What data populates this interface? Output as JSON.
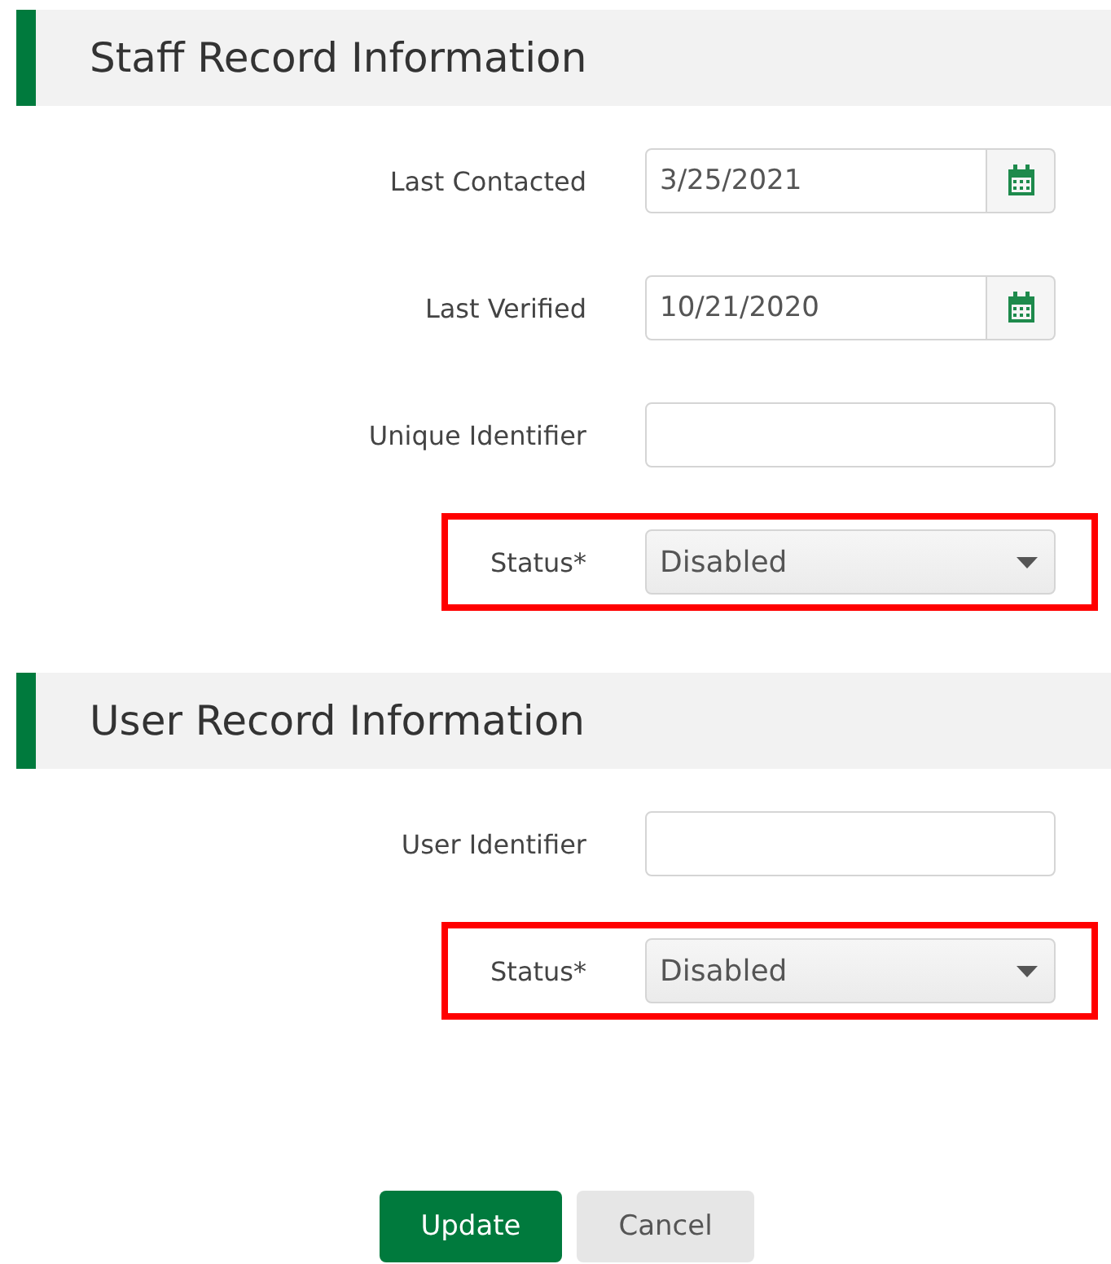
{
  "sections": [
    {
      "title": "Staff Record Information",
      "fields": [
        {
          "kind": "date",
          "label": "Last Contacted",
          "value": "3/25/2021",
          "highlighted": false
        },
        {
          "kind": "date",
          "label": "Last Verified",
          "value": "10/21/2020",
          "highlighted": false
        },
        {
          "kind": "text",
          "label": "Unique Identifier",
          "highlighted": false
        },
        {
          "kind": "select",
          "label": "Status*",
          "value": "Disabled",
          "highlighted": true
        }
      ]
    },
    {
      "title": "User Record Information",
      "fields": [
        {
          "kind": "text",
          "label": "User Identifier",
          "highlighted": false
        },
        {
          "kind": "select",
          "label": "Status*",
          "value": "Disabled",
          "highlighted": true
        }
      ]
    }
  ],
  "buttons": [
    {
      "kind": "primary",
      "label": "Update"
    },
    {
      "kind": "secondary",
      "label": "Cancel"
    }
  ]
}
